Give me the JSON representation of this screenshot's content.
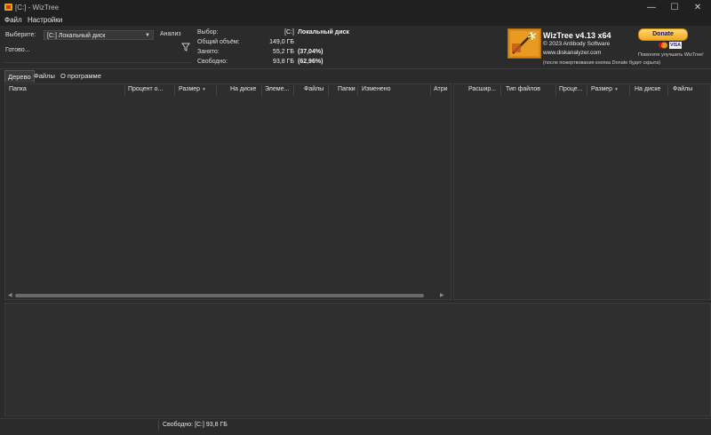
{
  "window": {
    "title": "[C:] - WizTree",
    "buttons": {
      "minimize": "—",
      "maximize": "☐",
      "close": "✕"
    }
  },
  "menu": {
    "items": [
      "Файл",
      "Настройки"
    ]
  },
  "header": {
    "select_label": "Выберите:",
    "drive_value": "[C:] Локальный диск",
    "analyze_label": "Анализ",
    "status": "Готово..."
  },
  "info": {
    "selection_label": "Выбор:",
    "selection_drive": "[C:]",
    "selection_name": "Локальный диск",
    "total_label": "Общий объём:",
    "total_value": "149,0 ГБ",
    "used_label": "Занято:",
    "used_value": "55,2 ГБ",
    "used_pct": "(37,04%)",
    "free_label": "Свободно:",
    "free_value": "93,8 ГБ",
    "free_pct": "(62,96%)"
  },
  "about": {
    "product": "WizTree v4.13 x64",
    "copyright": "© 2023 Antibody Software",
    "website": "www.diskanalyzer.com",
    "donate_note": "(после пожертвования кнопка Donate будет скрыта)",
    "donate_label": "Donate",
    "help_text": "Помогите улучшить WizTree!",
    "visa_label": "VISA"
  },
  "tabs": [
    "Дерево",
    "Файлы",
    "О программе"
  ],
  "left_columns": [
    "Папка",
    "Процент о...",
    "Размер",
    "На диске",
    "Элеме...",
    "Файлы",
    "Папки",
    "Изменено",
    "Атри"
  ],
  "right_columns": [
    "Расшир...",
    "Тип файлов",
    "Проце...",
    "Размер",
    "На диске",
    "Файлы"
  ],
  "statusbar": {
    "free_text": "Свободно: [C:] 93,8 ГБ"
  },
  "colors": {
    "accent": "#e8a317",
    "background": "#2b2b2b",
    "titlebar": "#202020"
  }
}
